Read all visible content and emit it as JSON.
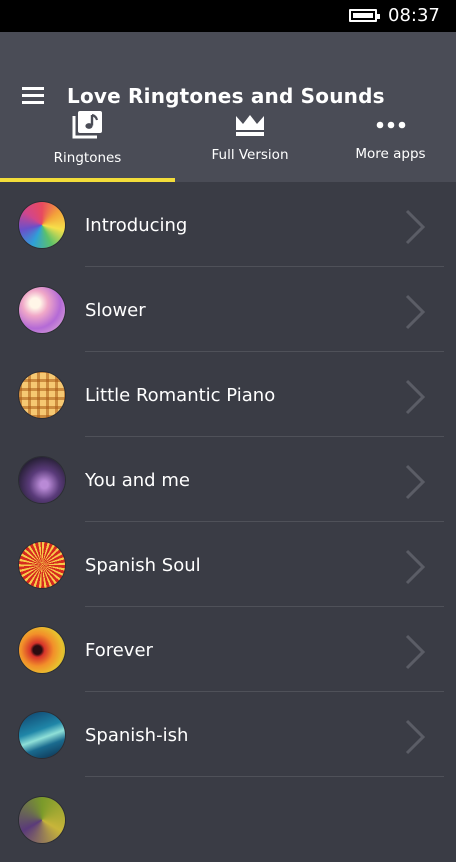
{
  "status_bar": {
    "time": "08:37",
    "battery_icon": "battery-full-icon"
  },
  "header": {
    "title": "Love Ringtones and Sounds",
    "menu_icon": "hamburger-menu-icon",
    "tabs": [
      {
        "label": "Ringtones",
        "icon": "music-library-icon",
        "selected": true
      },
      {
        "label": "Full Version",
        "icon": "crown-icon",
        "selected": false
      },
      {
        "label": "More apps",
        "icon": "more-dots-icon",
        "selected": false
      }
    ],
    "accent_color": "#f3dd3a"
  },
  "ringtones": [
    {
      "title": "Introducing",
      "thumb": "colorful-triangles"
    },
    {
      "title": "Slower",
      "thumb": "pink-bokeh"
    },
    {
      "title": "Little Romantic Piano",
      "thumb": "orange-plaid"
    },
    {
      "title": "You and me",
      "thumb": "purple-haze"
    },
    {
      "title": "Spanish Soul",
      "thumb": "red-sunburst"
    },
    {
      "title": "Forever",
      "thumb": "orange-rings"
    },
    {
      "title": "Spanish-ish",
      "thumb": "teal-wave"
    }
  ]
}
